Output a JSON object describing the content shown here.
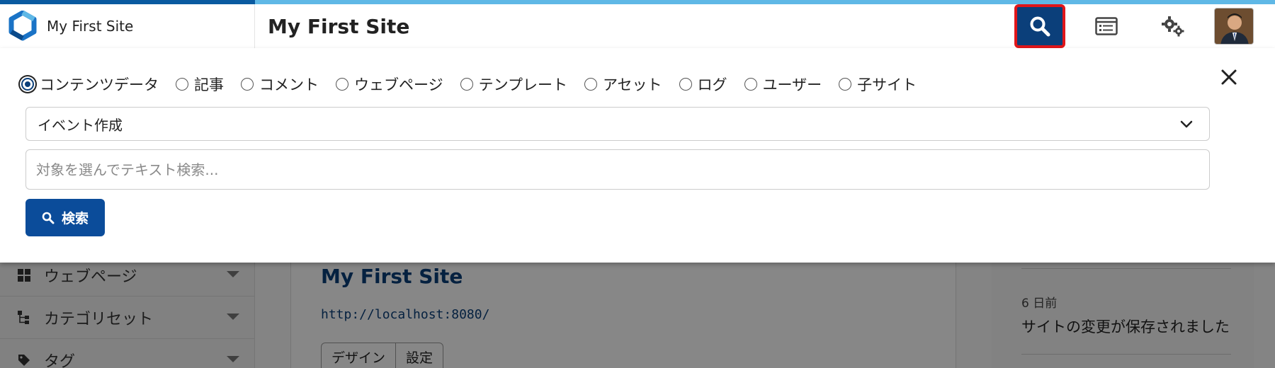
{
  "header": {
    "brand_name": "My First Site",
    "page_title": "My First Site",
    "actions": [
      {
        "name": "search-icon",
        "active": true
      },
      {
        "name": "list-icon"
      },
      {
        "name": "gear-icon"
      },
      {
        "name": "avatar"
      }
    ],
    "accent_colors": {
      "brand_blue": "#0b3f7a",
      "highlight_red": "#e0161a",
      "stripe_light": "#5fb8e6",
      "stripe_dark": "#0a5aa0"
    }
  },
  "search_panel": {
    "scopes": [
      {
        "label": "コンテンツデータ",
        "checked": true
      },
      {
        "label": "記事",
        "checked": false
      },
      {
        "label": "コメント",
        "checked": false
      },
      {
        "label": "ウェブページ",
        "checked": false
      },
      {
        "label": "テンプレート",
        "checked": false
      },
      {
        "label": "アセット",
        "checked": false
      },
      {
        "label": "ログ",
        "checked": false
      },
      {
        "label": "ユーザー",
        "checked": false
      },
      {
        "label": "子サイト",
        "checked": false
      }
    ],
    "content_type": "イベント作成",
    "query_placeholder": "対象を選んでテキスト検索...",
    "submit_label": "検索"
  },
  "sidebar": {
    "items": [
      {
        "label": "ウェブページ",
        "icon": "grid-icon"
      },
      {
        "label": "カテゴリセット",
        "icon": "hierarchy-icon"
      },
      {
        "label": "タグ",
        "icon": "tag-icon"
      }
    ]
  },
  "main": {
    "site_title": "My First Site",
    "site_url": "http://localhost:8080/",
    "tabs": [
      "デザイン",
      "設定"
    ]
  },
  "activity": {
    "when": "6 日前",
    "message": "サイトの変更が保存されました"
  }
}
